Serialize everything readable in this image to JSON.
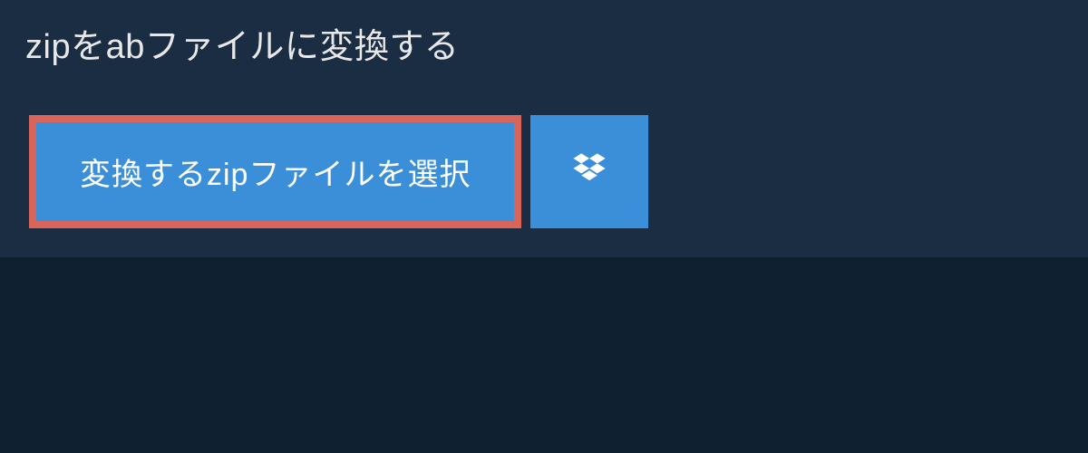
{
  "heading": "zipをabファイルに変換する",
  "buttons": {
    "select_label": "変換するzipファイルを選択"
  }
}
